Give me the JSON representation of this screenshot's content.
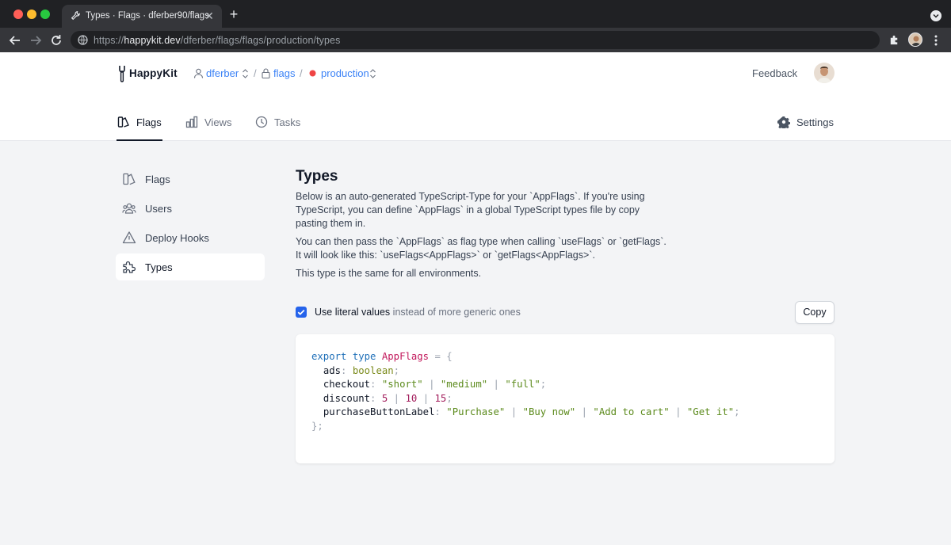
{
  "browser": {
    "tab_title": "Types · Flags · dferber90/flags",
    "url_scheme": "https://",
    "url_host": "happykit.dev",
    "url_path": "/dferber/flags/flags/production/types"
  },
  "header": {
    "logo_text": "HappyKit",
    "breadcrumbs": {
      "owner": "dferber",
      "project": "flags",
      "environment": "production",
      "separator": "/"
    },
    "feedback_label": "Feedback"
  },
  "main_tabs": [
    {
      "label": "Flags",
      "icon": "flags-icon",
      "active": true
    },
    {
      "label": "Views",
      "icon": "bar-chart-icon",
      "active": false
    },
    {
      "label": "Tasks",
      "icon": "clock-icon",
      "active": false
    }
  ],
  "settings_label": "Settings",
  "sidebar": {
    "items": [
      {
        "label": "Flags",
        "icon": "flags-icon"
      },
      {
        "label": "Users",
        "icon": "users-icon"
      },
      {
        "label": "Deploy Hooks",
        "icon": "warning-triangle-icon"
      },
      {
        "label": "Types",
        "icon": "puzzle-icon",
        "active": true
      }
    ]
  },
  "content": {
    "title": "Types",
    "p1_l1": "Below is an auto-generated TypeScript-Type for your `AppFlags`. If you're using",
    "p1_l2": "TypeScript, you can define `AppFlags` in a global TypeScript types file by copy",
    "p1_l3": "pasting them in.",
    "p2_l1": "You can then pass the `AppFlags` as flag type when calling `useFlags` or `getFlags`.",
    "p2_l2": "It will look like this: `useFlags<AppFlags>` or `getFlags<AppFlags>`.",
    "p3": "This type is the same for all environments.",
    "checkbox_strong": "Use literal values",
    "checkbox_rest": " instead of more generic ones",
    "checkbox_checked": true,
    "copy_label": "Copy"
  },
  "code": {
    "kw_export": "export",
    "kw_type": "type",
    "type_name": "AppFlags",
    "eq_open": " = {",
    "ads_key": "ads",
    "ads_type": "boolean",
    "checkout_key": "checkout",
    "checkout_v1": "\"short\"",
    "checkout_v2": "\"medium\"",
    "checkout_v3": "\"full\"",
    "discount_key": "discount",
    "discount_v1": "5",
    "discount_v2": "10",
    "discount_v3": "15",
    "purchase_key": "purchaseButtonLabel",
    "purchase_v1": "\"Purchase\"",
    "purchase_v2": "\"Buy now\"",
    "purchase_v3": "\"Add to cart\"",
    "purchase_v4": "\"Get it\"",
    "close": "};"
  },
  "colors": {
    "accent": "#3b82f6",
    "checkbox": "#2563eb",
    "env_dot": "#ef4444"
  }
}
